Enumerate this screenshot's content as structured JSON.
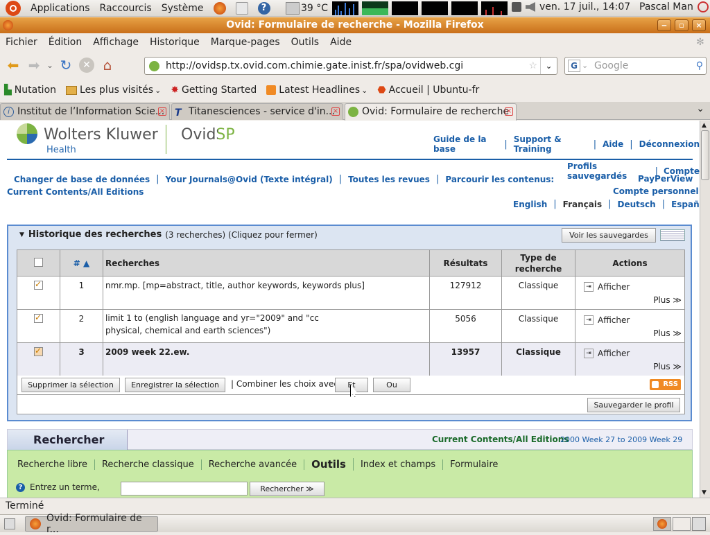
{
  "panel": {
    "applications": "Applications",
    "shortcuts": "Raccourcis",
    "system": "Système",
    "temperature": "39 °C",
    "datetime": "ven. 17 juil., 14:07",
    "user": "Pascal Man"
  },
  "window": {
    "title": "Ovid: Formulaire de recherche - Mozilla Firefox"
  },
  "menubar": [
    "Fichier",
    "Édition",
    "Affichage",
    "Historique",
    "Marque-pages",
    "Outils",
    "Aide"
  ],
  "navbar": {
    "url": "http://ovidsp.tx.ovid.com.chimie.gate.inist.fr/spa/ovidweb.cgi",
    "search_placeholder": "Google"
  },
  "bookmarks": [
    "Nutation",
    "Les plus visités",
    "Getting Started",
    "Latest Headlines",
    "Accueil | Ubuntu-fr"
  ],
  "tabs": [
    {
      "label": "Institut de l’Information Scie..."
    },
    {
      "label": "Titanesciences - service d'in..."
    },
    {
      "label": "Ovid: Formulaire de recherche"
    }
  ],
  "header": {
    "brand": "Wolters Kluwer",
    "brand_sub": "Health",
    "product": "OvidSP",
    "links": [
      "Guide de la base",
      "Support & Training",
      "Aide",
      "Déconnexion"
    ]
  },
  "subnav": {
    "links": [
      "Changer de base de données",
      "Your Journals@Ovid (Texte intégral)",
      "Toutes les revues",
      "Parcourir les contenus:"
    ],
    "current_db": "Current Contents/All Editions",
    "right_links": [
      "Profils sauvegardés",
      "Compte",
      "PayPerView",
      "Compte personnel"
    ],
    "languages": [
      "English",
      "Français",
      "Deutsch",
      "Español"
    ]
  },
  "history": {
    "title": "Historique des recherches",
    "subtitle": "(3 recherches) (Cliquez pour fermer)",
    "view_saved": "Voir les sauvegardes",
    "columns": {
      "num": "#",
      "search": "Recherches",
      "results": "Résultats",
      "type": "Type de recherche",
      "actions": "Actions"
    },
    "rows": [
      {
        "num": "1",
        "search": "nmr.mp. [mp=abstract, title, author keywords, keywords plus]",
        "results": "127912",
        "type": "Classique",
        "show": "Afficher",
        "more": "Plus ≫"
      },
      {
        "num": "2",
        "search": "limit 1 to (english language and yr=\"2009\" and \"cc physical, chemical and earth sciences\")",
        "results": "5056",
        "type": "Classique",
        "show": "Afficher",
        "more": "Plus ≫"
      },
      {
        "num": "3",
        "search": "2009 week 22.ew.",
        "results": "13957",
        "type": "Classique",
        "show": "Afficher",
        "more": "Plus ≫"
      }
    ],
    "delete_selection": "Supprimer la sélection",
    "save_selection": "Enregistrer la sélection",
    "combine_label": "| Combiner les choix avec :",
    "and": "Et",
    "or": "Ou",
    "rss": "RSS",
    "save_profile": "Sauvegarder le profil"
  },
  "search": {
    "title": "Rechercher",
    "db": "Current Contents/All Editions",
    "db_range": "2000 Week 27 to 2009 Week 29",
    "tabs": [
      "Recherche libre",
      "Recherche classique",
      "Recherche avancée",
      "Outils",
      "Index et champs",
      "Formulaire"
    ],
    "prompt": "Entrez un terme,",
    "button": "Rechercher ≫"
  },
  "status": "Terminé",
  "taskbar": {
    "item": "Ovid: Formulaire de r..."
  }
}
